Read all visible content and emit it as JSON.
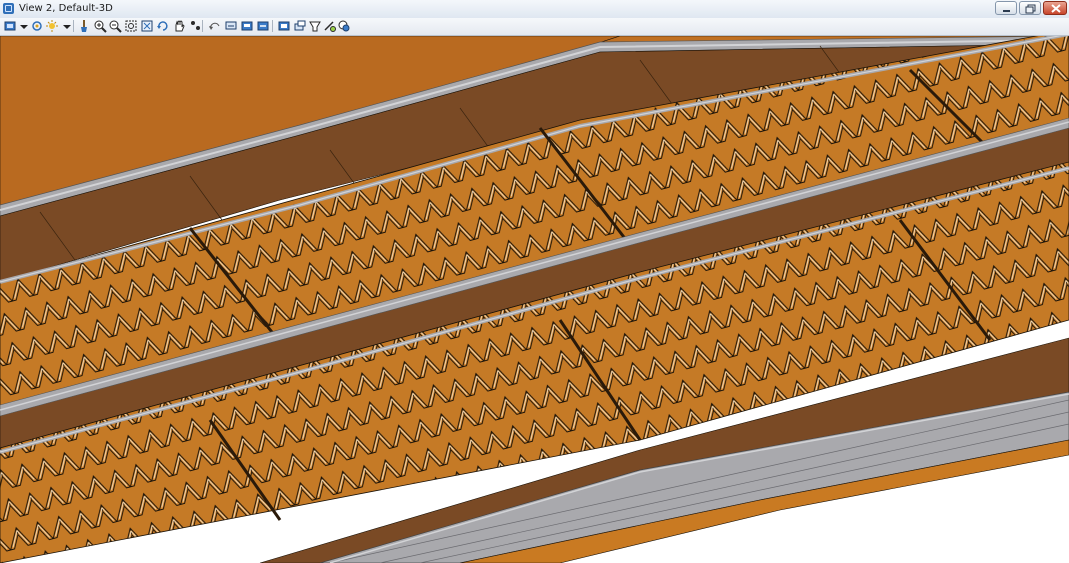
{
  "window": {
    "title": "View 2, Default-3D",
    "controls": {
      "minimize": "minimize",
      "restore": "restore",
      "close": "close"
    }
  },
  "toolbar": {
    "tools": [
      "view-display-icon",
      "dropdown-arrow-icon",
      "view-attributes-icon",
      "lighting-icon",
      "dropdown-arrow-icon",
      "brush-icon",
      "zoom-in-icon",
      "zoom-out-icon",
      "window-area-icon",
      "fit-view-icon",
      "rotate-view-icon",
      "pan-view-icon",
      "walk-icon",
      "previous-view-icon",
      "next-view-icon",
      "copy-view-icon",
      "view-previous-icon",
      "view-next-icon",
      "camera-setup-icon",
      "clip-volume-icon",
      "render-icon",
      "display-style-icon"
    ]
  },
  "viewport": {
    "colors": {
      "terrain": "#b96a20",
      "terrain_dark": "#7a4a25",
      "panel": "#c57a26",
      "road_gray": "#a9a9ad",
      "road_light": "#d2d3d6",
      "edge": "#1a1208",
      "background": "#ffffff"
    }
  }
}
